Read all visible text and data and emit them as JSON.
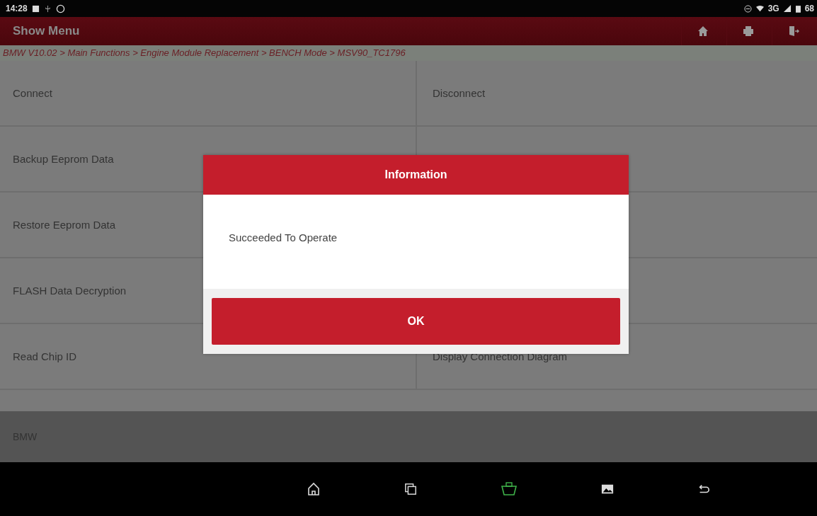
{
  "status_bar": {
    "time": "14:28",
    "network": "3G",
    "battery": "68"
  },
  "header": {
    "title": "Show Menu"
  },
  "breadcrumb": "BMW V10.02 > Main Functions  > Engine Module Replacement > BENCH Mode > MSV90_TC1796",
  "menu": [
    {
      "left": "Connect",
      "right": "Disconnect"
    },
    {
      "left": "Backup Eeprom Data"
    },
    {
      "left": "Restore Eeprom Data"
    },
    {
      "left": "FLASH Data Decryption"
    },
    {
      "left": "Read Chip ID",
      "right": "Display Connection Diagram"
    }
  ],
  "footer": "BMW",
  "dialog": {
    "title": "Information",
    "message": "Succeeded To Operate",
    "button": "OK"
  }
}
